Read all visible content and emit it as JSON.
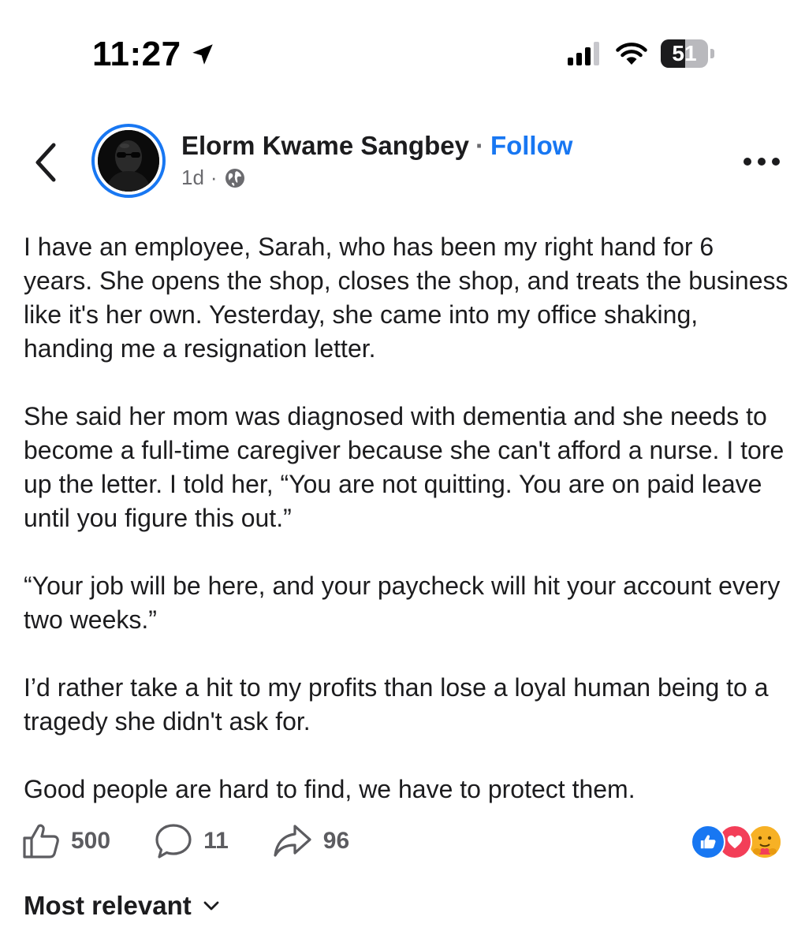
{
  "status_bar": {
    "time": "11:27",
    "battery_level": "51",
    "battery_fraction": 0.51,
    "icons": [
      "location-arrow-icon",
      "cellular-signal-icon",
      "wifi-icon",
      "battery-icon"
    ]
  },
  "header": {
    "back_icon": "chevron-left-icon",
    "author_name": "Elorm Kwame Sangbey",
    "separator": "·",
    "follow_label": "Follow",
    "timestamp": "1d",
    "meta_separator": "·",
    "privacy_icon": "globe-icon",
    "more_icon": "more-options-icon"
  },
  "post": {
    "paragraphs": [
      "I have an employee, Sarah, who has been my right hand for 6 years. She opens the shop, closes the shop, and treats the business like it's her own. Yesterday, she came into my office shaking, handing me a resignation letter.",
      "She said her mom was diagnosed with dementia and she needs to become a full-time caregiver because she can't afford a nurse. I tore up the letter. I told her, “You are not quitting. You are on paid leave until you figure this out.”",
      "“Your job will be here, and your paycheck will hit your account every two weeks.”",
      "I’d rather take a hit to my profits than lose a loyal human being to a tragedy she didn't ask for.",
      "Good people are hard to find, we have to protect them."
    ]
  },
  "actions": {
    "like_count": "500",
    "comment_count": "11",
    "share_count": "96"
  },
  "reactions": [
    "like",
    "love",
    "care"
  ],
  "colors": {
    "accent": "#1877f2",
    "love": "#f33e58",
    "care": "#f7b125",
    "muted": "#6b6b6f"
  },
  "comments": {
    "sort_label": "Most relevant"
  }
}
